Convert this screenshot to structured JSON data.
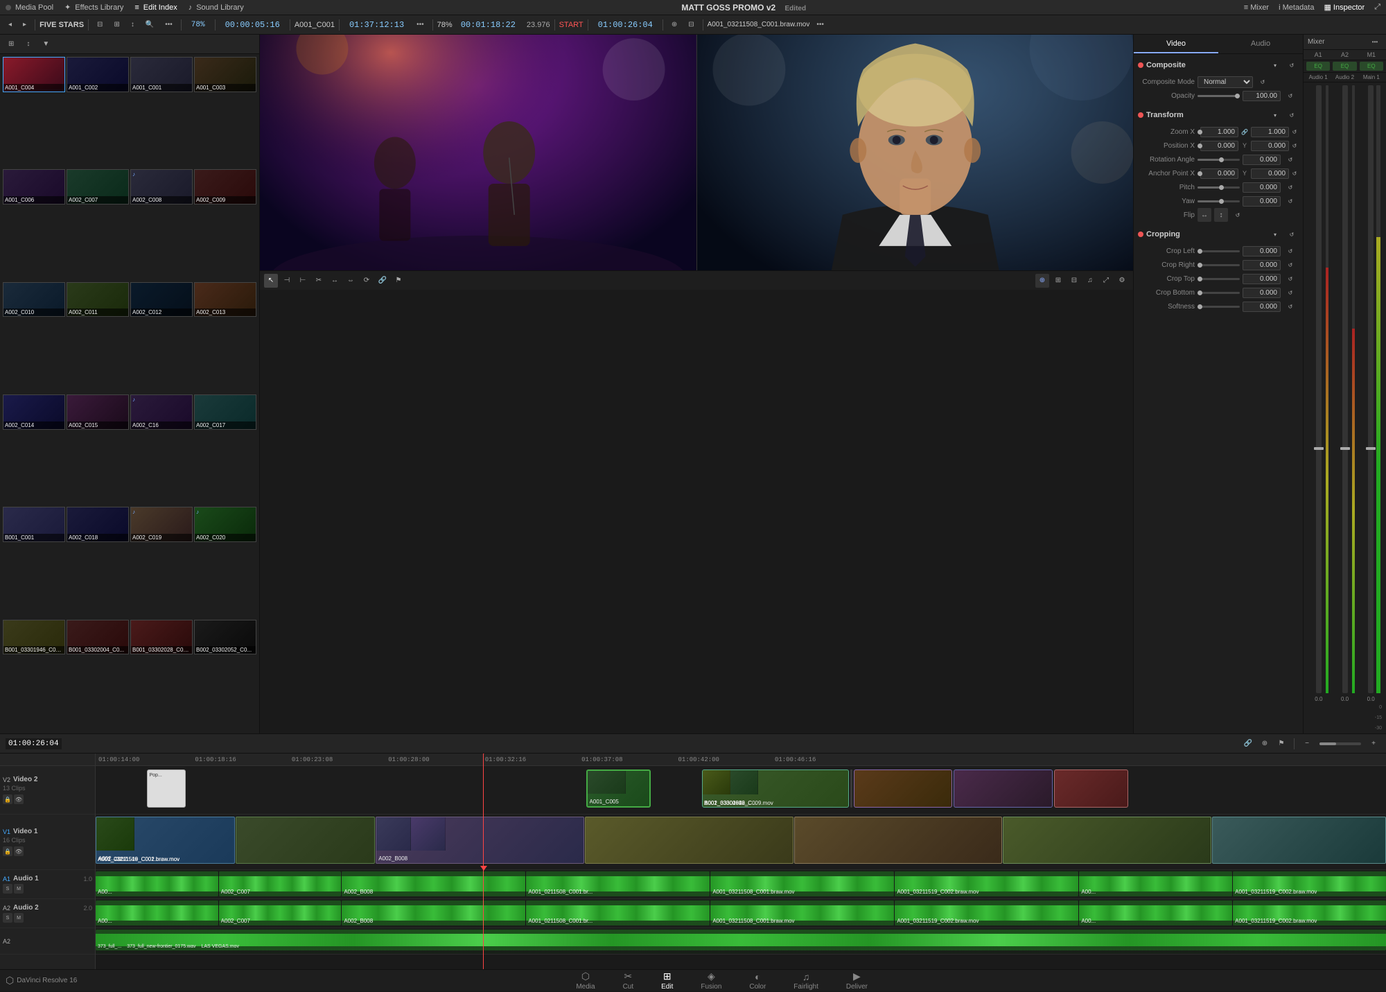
{
  "app": {
    "title": "DaVinci Resolve 16",
    "project_name": "MATT GOSS PROMO v2",
    "status": "Edited"
  },
  "top_bar": {
    "sections": [
      {
        "id": "media_pool",
        "label": "Media Pool",
        "icon": "■"
      },
      {
        "id": "effects_library",
        "label": "Effects Library",
        "icon": "✦"
      },
      {
        "id": "edit_index",
        "label": "Edit Index",
        "icon": "≡"
      },
      {
        "id": "sound_library",
        "label": "Sound Library",
        "icon": "♪"
      }
    ],
    "right_sections": [
      {
        "id": "mixer",
        "label": "Mixer",
        "icon": "≡"
      },
      {
        "id": "metadata",
        "label": "Metadata",
        "icon": "i"
      },
      {
        "id": "inspector",
        "label": "Inspector",
        "icon": "▦"
      }
    ]
  },
  "toolbar": {
    "zoom": "78%",
    "timecode": "00:00:05:16",
    "clip_name": "A001_C001",
    "timeline_tc": "01:37:12:13",
    "zoom2": "78%",
    "tc2": "00:01:18:22",
    "fps": "23.976",
    "start": "START",
    "tc3": "01:00:26:04",
    "current_clip": "A001_03211508_C001.braw.mov"
  },
  "media_panel": {
    "bin_name": "FIVE STARS",
    "clips": [
      {
        "id": "A001_C004",
        "color": "thumb-color-1",
        "selected": true
      },
      {
        "id": "A001_C002",
        "color": "thumb-color-2"
      },
      {
        "id": "A001_C001",
        "color": "thumb-color-3"
      },
      {
        "id": "A001_C003",
        "color": "thumb-color-4"
      },
      {
        "id": "A001_C006",
        "color": "thumb-color-5"
      },
      {
        "id": "A002_C007",
        "color": "thumb-color-6"
      },
      {
        "id": "A002_C008",
        "color": "thumb-color-3"
      },
      {
        "id": "A002_C009",
        "color": "thumb-color-7"
      },
      {
        "id": "A002_C010",
        "color": "thumb-color-8"
      },
      {
        "id": "A002_C011",
        "color": "thumb-color-9"
      },
      {
        "id": "A002_C012",
        "color": "thumb-color-10"
      },
      {
        "id": "A002_C013",
        "color": "thumb-color-11"
      },
      {
        "id": "A002_C014",
        "color": "thumb-color-12"
      },
      {
        "id": "A002_C015",
        "color": "thumb-color-13"
      },
      {
        "id": "A002_C16",
        "color": "thumb-color-5"
      },
      {
        "id": "A002_C017",
        "color": "thumb-color-14"
      },
      {
        "id": "B001_C001",
        "color": "thumb-color-15"
      },
      {
        "id": "A002_C018",
        "color": "thumb-color-2"
      },
      {
        "id": "A002_C019",
        "color": "thumb-color-16"
      },
      {
        "id": "A002_C020",
        "color": "thumb-color-17"
      },
      {
        "id": "B001_03301946_C02...",
        "color": "thumb-color-18"
      },
      {
        "id": "B001_03302004_C0...",
        "color": "thumb-color-7"
      },
      {
        "id": "B001_03302028_C04...",
        "color": "thumb-color-19"
      },
      {
        "id": "B002_03302052_C0...",
        "color": "thumb-color-20"
      }
    ]
  },
  "inspector": {
    "tabs": [
      {
        "id": "video",
        "label": "Video",
        "active": true
      },
      {
        "id": "audio",
        "label": "Audio"
      }
    ],
    "composite": {
      "title": "Composite",
      "mode_label": "Composite Mode",
      "mode_value": "Normal",
      "opacity_label": "Opacity",
      "opacity_value": "100.00"
    },
    "transform": {
      "title": "Transform",
      "zoom_label": "Zoom X",
      "zoom_x": "1.000",
      "zoom_y": "1.000",
      "pos_label": "Position X",
      "pos_x": "0.000",
      "pos_y": "0.000",
      "rotation_label": "Rotation Angle",
      "rotation_value": "0.000",
      "anchor_label": "Anchor Point X",
      "anchor_x": "0.000",
      "anchor_y": "0.000",
      "pitch_label": "Pitch",
      "pitch_value": "0.000",
      "yaw_label": "Yaw",
      "yaw_value": "0.000"
    },
    "cropping": {
      "title": "Cropping",
      "crop_left_label": "Crop Left",
      "crop_left_value": "0.000",
      "crop_right_label": "Crop Right",
      "crop_right_value": "0.000",
      "crop_top_label": "Crop Top",
      "crop_top_value": "0.000",
      "crop_bottom_label": "Crop Bottom",
      "crop_bottom_value": "0.000",
      "softness_label": "Softness",
      "softness_value": "0.000"
    }
  },
  "timeline": {
    "timecode": "01:00:26:04",
    "tracks": {
      "v2": {
        "name": "Video 2",
        "clips_count": "13 Clips"
      },
      "v1": {
        "name": "Video 1",
        "clips_count": "16 Clips"
      },
      "a1": {
        "name": "Audio 1",
        "gain": "1.0"
      },
      "a2": {
        "name": "Audio 2",
        "gain": "2.0"
      },
      "a3": {
        "name": ""
      }
    },
    "ruler_marks": [
      "01:00:14:00",
      "01:00:18:16",
      "01:00:23:08",
      "01:00:28:00",
      "01:00:32:16",
      "01:00:37:08",
      "01:00:42:00",
      "01:00:46:16"
    ]
  },
  "bottom_tabs": [
    {
      "id": "media",
      "label": "Media",
      "icon": "⬡"
    },
    {
      "id": "cut",
      "label": "Cut",
      "icon": "✂"
    },
    {
      "id": "edit",
      "label": "Edit",
      "icon": "⊞",
      "active": true
    },
    {
      "id": "fusion",
      "label": "Fusion",
      "icon": "◈"
    },
    {
      "id": "color",
      "label": "Color",
      "icon": "◐"
    },
    {
      "id": "fairlight",
      "label": "Fairlight",
      "icon": "♫"
    },
    {
      "id": "deliver",
      "label": "Deliver",
      "icon": "▶"
    }
  ],
  "mixer": {
    "title": "Mixer",
    "channels": [
      {
        "id": "a1",
        "label": "Audio 1"
      },
      {
        "id": "a2",
        "label": "Audio 2"
      },
      {
        "id": "m1",
        "label": "Main 1"
      }
    ]
  }
}
